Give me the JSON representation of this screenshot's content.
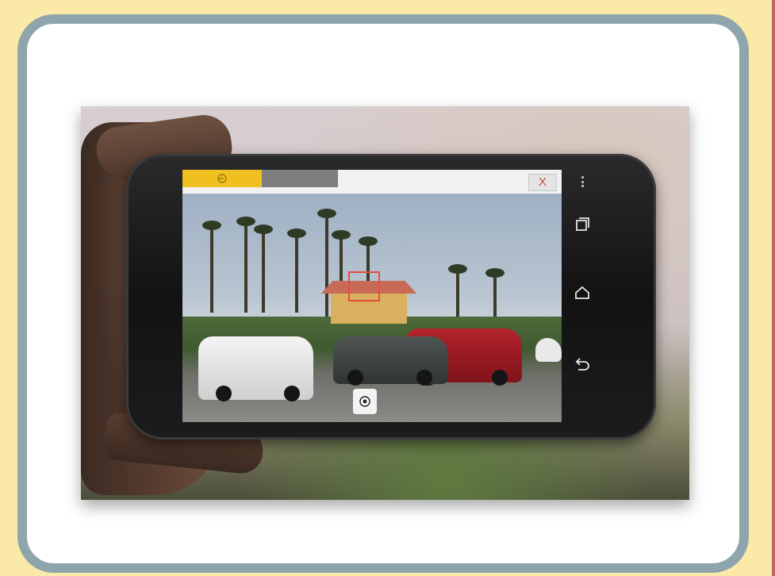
{
  "camera_app": {
    "close_label": "X"
  },
  "colors": {
    "background": "#fbe9a8",
    "card_border": "#8ea5ac",
    "progress_fill": "#f0c020",
    "focus_box": "#e84b3e"
  },
  "icons": {
    "progress_icon": "refresh-icon",
    "shutter": "shutter-icon",
    "recent_apps": "recent-apps-icon",
    "home": "home-icon",
    "back": "back-icon",
    "overflow": "overflow-menu-icon"
  }
}
